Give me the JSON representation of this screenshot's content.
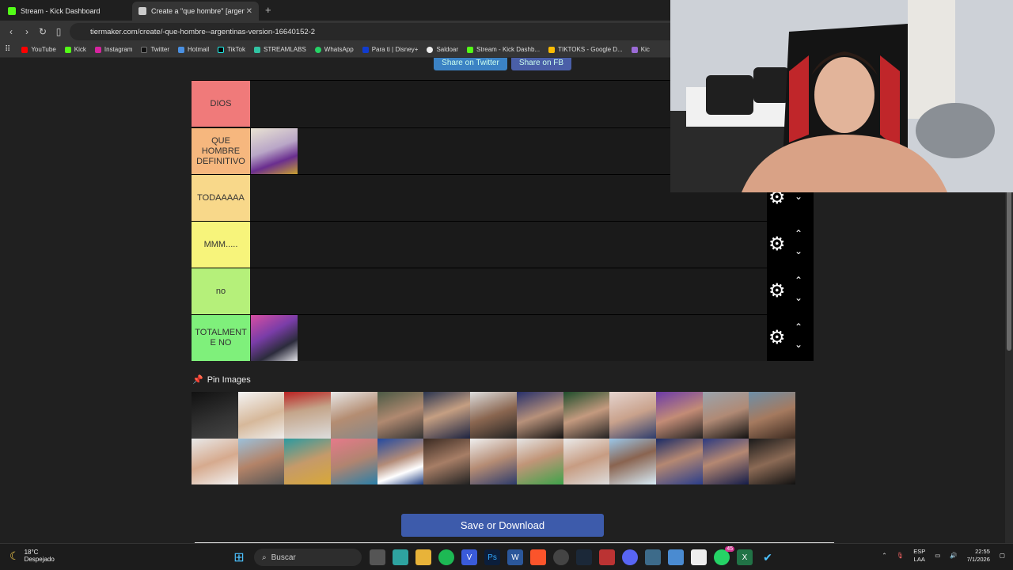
{
  "browser": {
    "tabs": [
      {
        "label": "Stream - Kick Dashboard",
        "active": false
      },
      {
        "label": "Create a \"que hombre\" [argentin",
        "active": true
      }
    ],
    "url": "tiermaker.com/create/-que-hombre--argentinas-version-16640152-2",
    "bookmarks": [
      "YouTube",
      "Kick",
      "Instagram",
      "Twitter",
      "Hotmail",
      "TikTok",
      "STREAMLABS",
      "WhatsApp",
      "Para ti | Disney+",
      "Saldoar",
      "Stream - Kick Dashb...",
      "TIKTOKS - Google D...",
      "Kic"
    ]
  },
  "share": {
    "twitter": "Share on Twitter",
    "fb": "Share on FB"
  },
  "tiers": [
    {
      "label": "DIOS",
      "color": "#f07a7a"
    },
    {
      "label": "QUE HOMBRE DEFINITIVO",
      "color": "#f6b77e"
    },
    {
      "label": "TODAAAAA",
      "color": "#f8d88a"
    },
    {
      "label": "MMM.....",
      "color": "#f7f47b"
    },
    {
      "label": "no",
      "color": "#b5f07a"
    },
    {
      "label": "TOTALMENTE NO",
      "color": "#7ff07b"
    }
  ],
  "pin_label": "Pin Images",
  "save_label": "Save or Download",
  "taskbar": {
    "temperature": "18°C",
    "condition": "Despejado",
    "search": "Buscar",
    "lang": "ESP",
    "layout": "LAA",
    "time": "22:55",
    "date": "7/1/2026",
    "whatsapp_badge": "45"
  }
}
